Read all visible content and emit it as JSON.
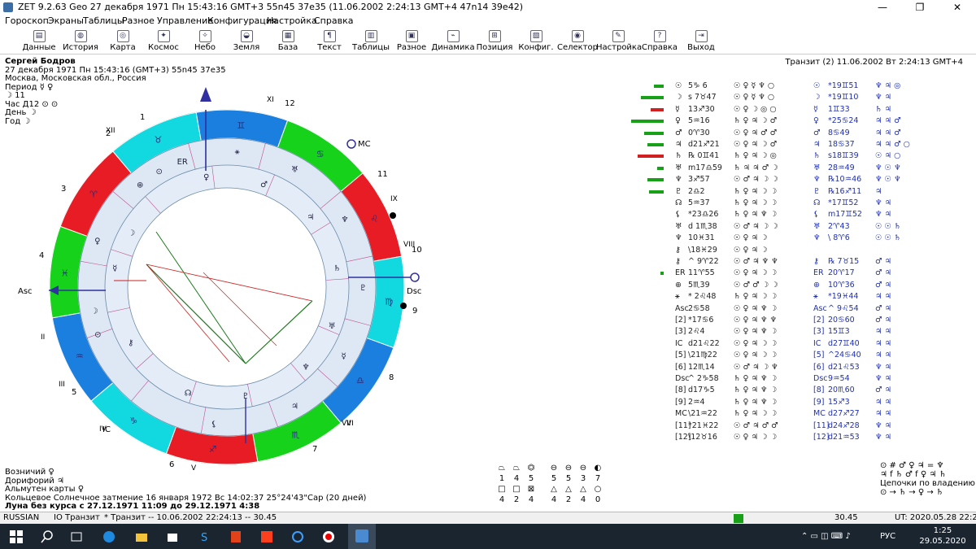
{
  "window": {
    "title": "ZET 9.2.63 Geo   27 декабря 1971  Пн  15:43:16 GMT+3 55n45  37e35   (11.06.2002   2:24:13 GMT+4 47n14 39e42)",
    "minimize": "—",
    "maximize": "❐",
    "close": "✕"
  },
  "menu": [
    "Гороскоп",
    "Экраны",
    "Таблицы",
    "Разное",
    "Управление",
    "Конфигурация",
    "Настройка",
    "Справка"
  ],
  "toolbar": [
    {
      "label": "Данные",
      "icon": "folder-icon",
      "glyph": "▤"
    },
    {
      "label": "История",
      "icon": "globe-icon",
      "glyph": "◍"
    },
    {
      "label": "Карта",
      "icon": "chart-wheel-icon",
      "glyph": "◎"
    },
    {
      "label": "Космос",
      "icon": "cosmos-icon",
      "glyph": "✦"
    },
    {
      "label": "Небо",
      "icon": "sky-icon",
      "glyph": "✧"
    },
    {
      "label": "Земля",
      "icon": "earth-icon",
      "glyph": "◒"
    },
    {
      "label": "База",
      "icon": "database-icon",
      "glyph": "▦"
    },
    {
      "label": "Текст",
      "icon": "text-icon",
      "glyph": "¶"
    },
    {
      "label": "Таблицы",
      "icon": "tables-icon",
      "glyph": "▥"
    },
    {
      "label": "Разное",
      "icon": "misc-icon",
      "glyph": "▣"
    },
    {
      "label": "Динамика",
      "icon": "dynamics-icon",
      "glyph": "⌁"
    },
    {
      "label": "Позиция",
      "icon": "position-icon",
      "glyph": "⊞"
    },
    {
      "label": "Конфиг.",
      "icon": "config-icon",
      "glyph": "▧"
    },
    {
      "label": "Селектор",
      "icon": "selector-icon",
      "glyph": "◉"
    },
    {
      "label": "Настройка",
      "icon": "settings-icon",
      "glyph": "✎"
    },
    {
      "label": "Справка",
      "icon": "help-icon",
      "glyph": "?"
    },
    {
      "label": "Выход",
      "icon": "exit-icon",
      "glyph": "⇥"
    }
  ],
  "person": {
    "name": "Сергей Бодров",
    "datetime": "27 декабря 1971  Пн  15:43:16 (GMT+3) 55n45  37e35",
    "place": "Москва, Московская обл., Россия",
    "period": "Период  ☿ ♀",
    "moon": "☽  11",
    "hour": "Час Д12 ⊙ ⊙",
    "day": "День ☽",
    "year": "Год ☽"
  },
  "transit_header": "Транзит (2) 11.06.2002  Вт  2:24:13 GMT+4",
  "wheel": {
    "houses_outer": [
      "1",
      "12",
      "11",
      "10",
      "9",
      "8",
      "7",
      "6",
      "5",
      "4",
      "3",
      "2"
    ],
    "roman": [
      "XII",
      "XI",
      "IX",
      "VIII",
      "VII",
      "VI",
      "V",
      "IV",
      "III",
      "II"
    ],
    "asc_label": "Asc",
    "dsc_label": "Dsc",
    "mc_label": "MC",
    "ic_label": "IC",
    "sign_colors": [
      "#e81c24",
      "#12d8e0",
      "#1b7fe0",
      "#16d21a"
    ]
  },
  "aspect_table": {
    "left_rows": [
      {
        "p": "☉",
        "s": "5♑ 6",
        "a": "☉ ♀ ☿ ♆ ○"
      },
      {
        "p": "☽",
        "s": "s 7♉47",
        "a": "☉ ♀ ☿ ♆ ○"
      },
      {
        "p": "☿",
        "s": "13♐30",
        "a": "☉ ♀ ☽ ◎ ○"
      },
      {
        "p": "♀",
        "s": "5♒16",
        "a": "♄ ♀ ♃ ☽ ♂"
      },
      {
        "p": "♂",
        "s": "0♈30",
        "a": "☉ ♀ ♃ ♂ ♂"
      },
      {
        "p": "♃",
        "s": "d21♐21",
        "a": "☉ ♀ ♃ ☽ ♂"
      },
      {
        "p": "♄",
        "s": "℞ 0♊41",
        "a": "♄ ♀ ♃ ☽ ◎"
      },
      {
        "p": "♅",
        "s": "m17♎59",
        "a": "♄ ♃ ♃ ♂ ☽"
      },
      {
        "p": "♆",
        "s": "3♐57",
        "a": "☉ ♂ ♃ ☽ ☽"
      },
      {
        "p": "♇",
        "s": "2♎2",
        "a": "♄ ♀ ♃ ☽ ☽"
      },
      {
        "p": "☊",
        "s": "5♒37",
        "a": "♄ ♀ ♃ ☽ ☽"
      },
      {
        "p": "⚸",
        "s": "*23♎26",
        "a": "♄ ♀ ♃ ♆ ☽"
      },
      {
        "p": "♅",
        "s": "d 1♏38",
        "a": "☉ ♂ ♃ ☽ ☽"
      },
      {
        "p": "♆",
        "s": "10♓31",
        "a": "☉ ♀ ♃ ☽"
      },
      {
        "p": "⚷",
        "s": "\\18♓29",
        "a": "☉ ♀ ♃ ☽"
      },
      {
        "p": "⚷",
        "s": "^ 9♈22",
        "a": "☉ ♂ ♃ ♆ ♆"
      },
      {
        "p": "ER",
        "s": "11♈55",
        "a": "☉ ♀ ♃ ☽ ☽"
      },
      {
        "p": "⊕",
        "s": "5♏39",
        "a": "☉ ♂ ♂ ☽ ☽"
      },
      {
        "p": "⚹",
        "s": "* 2♌48",
        "a": "♄ ♀ ♃ ☽ ☽"
      },
      {
        "p": "Asc",
        "s": "2♋58",
        "a": "☉ ♀ ♃ ♆ ☽"
      },
      {
        "p": "[2]",
        "s": "*17♋6",
        "a": "☉ ♀ ♃ ♆ ♆"
      },
      {
        "p": "[3]",
        "s": "2♌4",
        "a": "☉ ♀ ♃ ♆ ☽"
      },
      {
        "p": "IC",
        "s": "d21♌22",
        "a": "☉ ♀ ♃ ☽ ☽"
      },
      {
        "p": "[5]",
        "s": "\\21♍22",
        "a": "☉ ♀ ♃ ☽ ☽"
      },
      {
        "p": "[6]",
        "s": "12♏14",
        "a": "☉ ♂ ♃ ☽ ♆"
      },
      {
        "p": "Dsc",
        "s": "^ 2♑58",
        "a": "♄ ♀ ♃ ♆ ☽"
      },
      {
        "p": "[8]",
        "s": "d17♑5",
        "a": "♄ ♀ ♃ ♆ ☽"
      },
      {
        "p": "[9]",
        "s": "2♒4",
        "a": "♄ ♀ ♃ ♆ ☽"
      },
      {
        "p": "MC",
        "s": "\\21♒22",
        "a": "♄ ♀ ♃ ☽ ☽"
      },
      {
        "p": "[11]",
        "s": "*21♓22",
        "a": "☉ ♂ ♃ ♂ ♂"
      },
      {
        "p": "[12]",
        "s": "\\12♉16",
        "a": "☉ ♀ ♃ ☽ ☽"
      }
    ],
    "right_rows": [
      {
        "p": "☉",
        "s": "*19♊51",
        "a": "♆ ♃ ◎"
      },
      {
        "p": "☽",
        "s": "*19♊10",
        "a": "♆ ♃"
      },
      {
        "p": "☿",
        "s": "1♊33",
        "a": "♄ ♃"
      },
      {
        "p": "♀",
        "s": "*25♋24",
        "a": "♃ ♃ ♂"
      },
      {
        "p": "♂",
        "s": "8♋49",
        "a": "♃ ♃ ♂"
      },
      {
        "p": "♃",
        "s": "18♋37",
        "a": "♃ ♃ ♂ ○"
      },
      {
        "p": "♄",
        "s": "s18♊39",
        "a": "☉ ♃ ○"
      },
      {
        "p": "♅",
        "s": "28♒49",
        "a": "♆ ☉ ♆"
      },
      {
        "p": "♆",
        "s": "℞10♒46",
        "a": "♆ ☉ ♆"
      },
      {
        "p": "♇",
        "s": "℞16♐11",
        "a": "♃"
      },
      {
        "p": "☊",
        "s": "*17♊52",
        "a": "♆ ♃"
      },
      {
        "p": "⚸",
        "s": "m17♊52",
        "a": "♆ ♃"
      },
      {
        "p": "♅",
        "s": "2♈43",
        "a": "☉ ☉ ♄"
      },
      {
        "p": "♆",
        "s": "\\ 8♈6",
        "a": "☉ ☉ ♄"
      },
      {
        "p": "",
        "s": "",
        "a": ""
      },
      {
        "p": "⚷",
        "s": "℞ 7♉15",
        "a": "♂ ♃"
      },
      {
        "p": "ER",
        "s": "20♈17",
        "a": "♂ ♃"
      },
      {
        "p": "⊕",
        "s": "10♈36",
        "a": "♂ ♃"
      },
      {
        "p": "⚹",
        "s": "*19♓44",
        "a": "♃ ♃"
      },
      {
        "p": "Asc",
        "s": "^ 9♌54",
        "a": "♂ ♃"
      },
      {
        "p": "[2]",
        "s": "20♋60",
        "a": "♂ ♃"
      },
      {
        "p": "[3]",
        "s": "15♊3",
        "a": "♃ ♃"
      },
      {
        "p": "IC",
        "s": "d27♊40",
        "a": "♃ ♃"
      },
      {
        "p": "[5]",
        "s": "^24♋40",
        "a": "♃ ♃"
      },
      {
        "p": "[6]",
        "s": "d21♌53",
        "a": "♆ ♃"
      },
      {
        "p": "Dsc",
        "s": "9♒54",
        "a": "♆ ♃"
      },
      {
        "p": "[8]",
        "s": "20♏60",
        "a": "♂ ♃"
      },
      {
        "p": "[9]",
        "s": "15♐3",
        "a": "♃ ♃"
      },
      {
        "p": "MC",
        "s": "d27♐27",
        "a": "♃ ♃"
      },
      {
        "p": "[11]",
        "s": "d24♐28",
        "a": "♆ ♃"
      },
      {
        "p": "[12]",
        "s": "d21♒53",
        "a": "♆ ♃"
      }
    ],
    "bar_levels": [
      0.3,
      0.7,
      0.4,
      1.0,
      0.6,
      0.5,
      0.8,
      0.2,
      0.5,
      0.45,
      0,
      0,
      0,
      0,
      0,
      0,
      0.1
    ]
  },
  "bottom_info": {
    "l1": "Возничий  ♀",
    "l2": "Дорифорий  ♃",
    "l3": "Альмутен карты  ♀",
    "l4": "Кольцевое Солнечное затмение 16 января 1972 Вс 14:02:37 25°24'43\"Cap (20 дней)",
    "l5": "Луна без курса с 27.12.1971 11:09 до 29.12.1971  4:38"
  },
  "glyph_grid": {
    "row1": [
      "⏢",
      "⏢",
      "⏣",
      "⊖",
      "⊖",
      "⊖",
      "◐"
    ],
    "row2": [
      "1",
      "4",
      "5",
      "5",
      "5",
      "3",
      "7"
    ],
    "row3": [
      "□",
      "□",
      "⊠",
      "△",
      "△",
      "△",
      "○"
    ],
    "row4": [
      "4",
      "2",
      "4",
      "4",
      "2",
      "4",
      "0"
    ]
  },
  "chains": {
    "l1": "⊙ # ♂ ♀ ♃ = ♆",
    "l2": "♃ f ♄ ♂ f ♀ ♃ ♄",
    "title": "Цепочки по владению:",
    "l3": "⊙ → ♄ → ♀ → ♄"
  },
  "status": {
    "lang": "RUSSIAN",
    "mode": "IO Транзит",
    "transit": "*  Транзит -- 10.06.2002 22:24:13 -- 30.45",
    "value": "30.45",
    "utc": "UT: 2020.05.28 22:25:44"
  },
  "tray": {
    "lang": "РУС",
    "time": "1:25",
    "date": "29.05.2020"
  }
}
